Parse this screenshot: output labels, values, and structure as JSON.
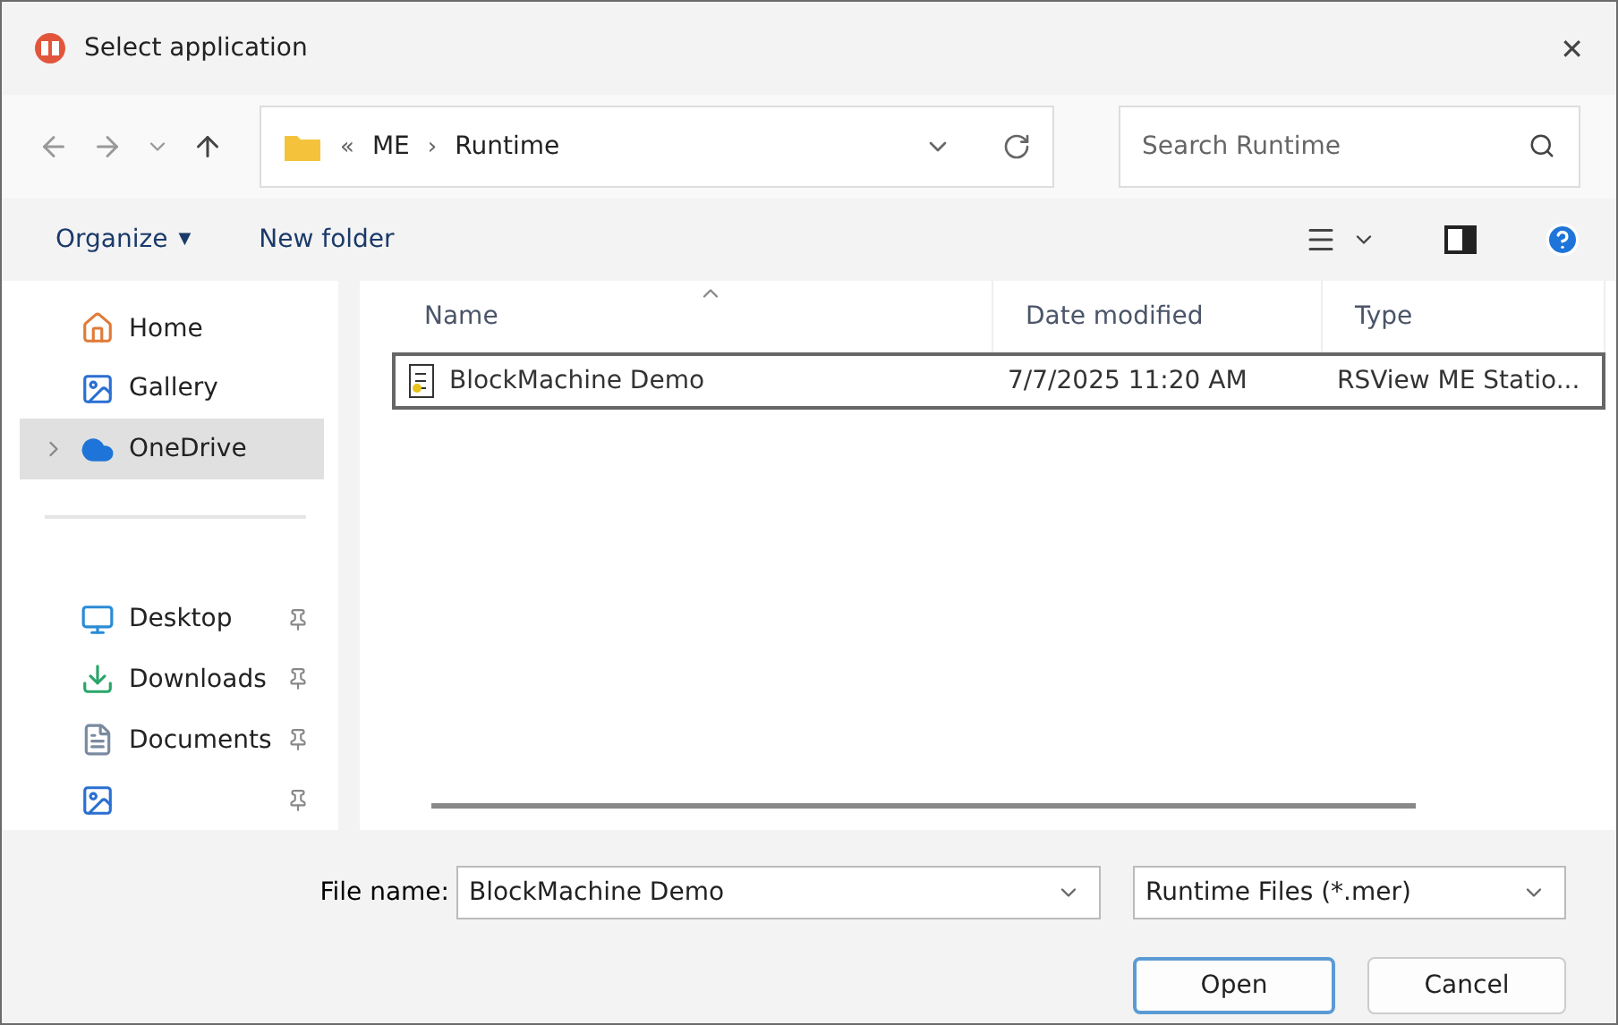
{
  "window": {
    "title": "Select application",
    "close": "✕"
  },
  "nav": {
    "breadcrumb": [
      "ME",
      "Runtime"
    ],
    "overflow": "«",
    "separator": "›",
    "search": {
      "placeholder": "Search Runtime"
    }
  },
  "toolbar": {
    "organize": "Organize",
    "organize_caret": "▼",
    "new_folder": "New folder"
  },
  "sidebar": {
    "items": [
      {
        "kind": "home",
        "label": "Home",
        "selected": false,
        "pinned": false,
        "expandable": false
      },
      {
        "kind": "gallery",
        "label": "Gallery",
        "selected": false,
        "pinned": false,
        "expandable": false
      },
      {
        "kind": "cloud",
        "label": "OneDrive",
        "selected": true,
        "pinned": false,
        "expandable": true
      },
      {
        "kind": "divider"
      },
      {
        "kind": "desktop",
        "label": "Desktop",
        "selected": false,
        "pinned": true,
        "expandable": false
      },
      {
        "kind": "downloads",
        "label": "Downloads",
        "selected": false,
        "pinned": true,
        "expandable": false
      },
      {
        "kind": "documents",
        "label": "Documents",
        "selected": false,
        "pinned": true,
        "expandable": false
      },
      {
        "kind": "pictures",
        "selected": false,
        "pinned": true,
        "expandable": false
      }
    ]
  },
  "table": {
    "columns": [
      "Name",
      "Date modified",
      "Type"
    ],
    "rows": [
      {
        "name": "BlockMachine Demo",
        "date": "7/7/2025 11:20 AM",
        "type": "RSView ME Statio...",
        "selected": true
      }
    ]
  },
  "footer": {
    "file_name_label": "File name:",
    "file_name": "BlockMachine Demo",
    "filter": "Runtime Files (*.mer)",
    "buttons": [
      {
        "label": "Open",
        "default": true
      },
      {
        "label": "Cancel",
        "default": false
      }
    ]
  }
}
